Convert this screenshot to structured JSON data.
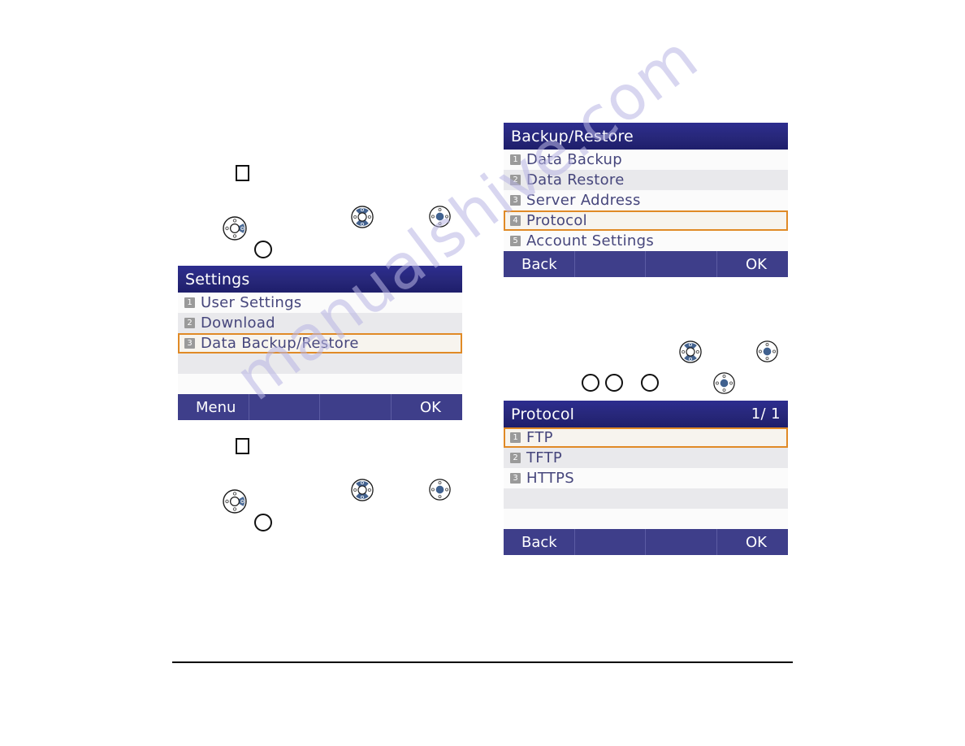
{
  "watermark": {
    "text": "manualshive.com"
  },
  "colors": {
    "title_bar": "#272779",
    "softkey_bar": "#3e3e8a",
    "selection_border": "#e08a26",
    "row_alt": "#e9e9ec",
    "row_plain": "#fbfbfb",
    "text": "#46467c",
    "number_badge": "#9a9a9a"
  },
  "screens": [
    {
      "id": "settings",
      "title": "Settings",
      "page": "",
      "rows": [
        {
          "num": "1",
          "label": "User Settings",
          "selected": false,
          "alt": false
        },
        {
          "num": "2",
          "label": "Download",
          "selected": false,
          "alt": true
        },
        {
          "num": "3",
          "label": "Data Backup/Restore",
          "selected": true,
          "alt": false
        },
        {
          "num": "",
          "label": "",
          "selected": false,
          "alt": true
        },
        {
          "num": "",
          "label": "",
          "selected": false,
          "alt": false
        }
      ],
      "softkeys": [
        "Menu",
        "",
        "",
        "OK"
      ]
    },
    {
      "id": "backup-restore",
      "title": "Backup/Restore",
      "page": "",
      "rows": [
        {
          "num": "1",
          "label": "Data Backup",
          "selected": false,
          "alt": false
        },
        {
          "num": "2",
          "label": "Data Restore",
          "selected": false,
          "alt": true
        },
        {
          "num": "3",
          "label": "Server Address",
          "selected": false,
          "alt": false
        },
        {
          "num": "4",
          "label": "Protocol",
          "selected": true,
          "alt": true
        },
        {
          "num": "5",
          "label": "Account Settings",
          "selected": false,
          "alt": false
        }
      ],
      "softkeys": [
        "Back",
        "",
        "",
        "OK"
      ]
    },
    {
      "id": "protocol",
      "title": "Protocol",
      "page": "1/ 1",
      "rows": [
        {
          "num": "1",
          "label": "FTP",
          "selected": true,
          "alt": false
        },
        {
          "num": "2",
          "label": "TFTP",
          "selected": false,
          "alt": true
        },
        {
          "num": "3",
          "label": "HTTPS",
          "selected": false,
          "alt": false
        },
        {
          "num": "",
          "label": "",
          "selected": false,
          "alt": true
        },
        {
          "num": "",
          "label": "",
          "selected": false,
          "alt": false
        }
      ],
      "softkeys": [
        "Back",
        "",
        "",
        "OK"
      ]
    }
  ],
  "keys": {
    "nav_right": "navigation-pad-right-icon",
    "nav_updown": "navigation-pad-up-down-icon",
    "nav_center": "navigation-pad-center-icon",
    "round": "round-key-icon",
    "square": "square-key-icon"
  }
}
